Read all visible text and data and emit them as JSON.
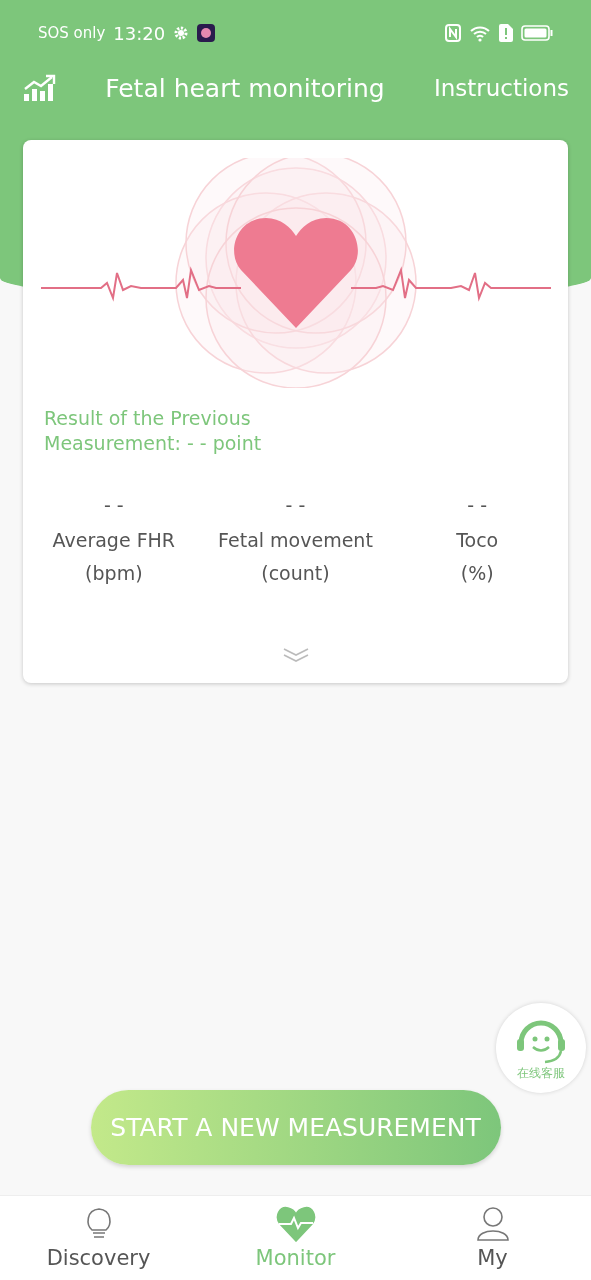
{
  "status_bar": {
    "carrier": "SOS only",
    "time": "13:20"
  },
  "header": {
    "title": "Fetal heart monitoring",
    "action": "Instructions"
  },
  "result_card": {
    "summary": "Result of the Previous Measurement: - - point",
    "stats": [
      {
        "value": "- -",
        "label": "Average FHR",
        "unit": "(bpm)"
      },
      {
        "value": "- -",
        "label": "Fetal movement",
        "unit": "(count)"
      },
      {
        "value": "- -",
        "label": "Toco",
        "unit": "(%)"
      }
    ]
  },
  "support_badge": {
    "label": "在线客服"
  },
  "start_button": {
    "label": "START A NEW MEASUREMENT"
  },
  "bottom_nav": [
    {
      "kind": "bulb",
      "label": "Discovery",
      "selected": false
    },
    {
      "kind": "heart",
      "label": "Monitor",
      "selected": true
    },
    {
      "kind": "person",
      "label": "My",
      "selected": false
    }
  ]
}
